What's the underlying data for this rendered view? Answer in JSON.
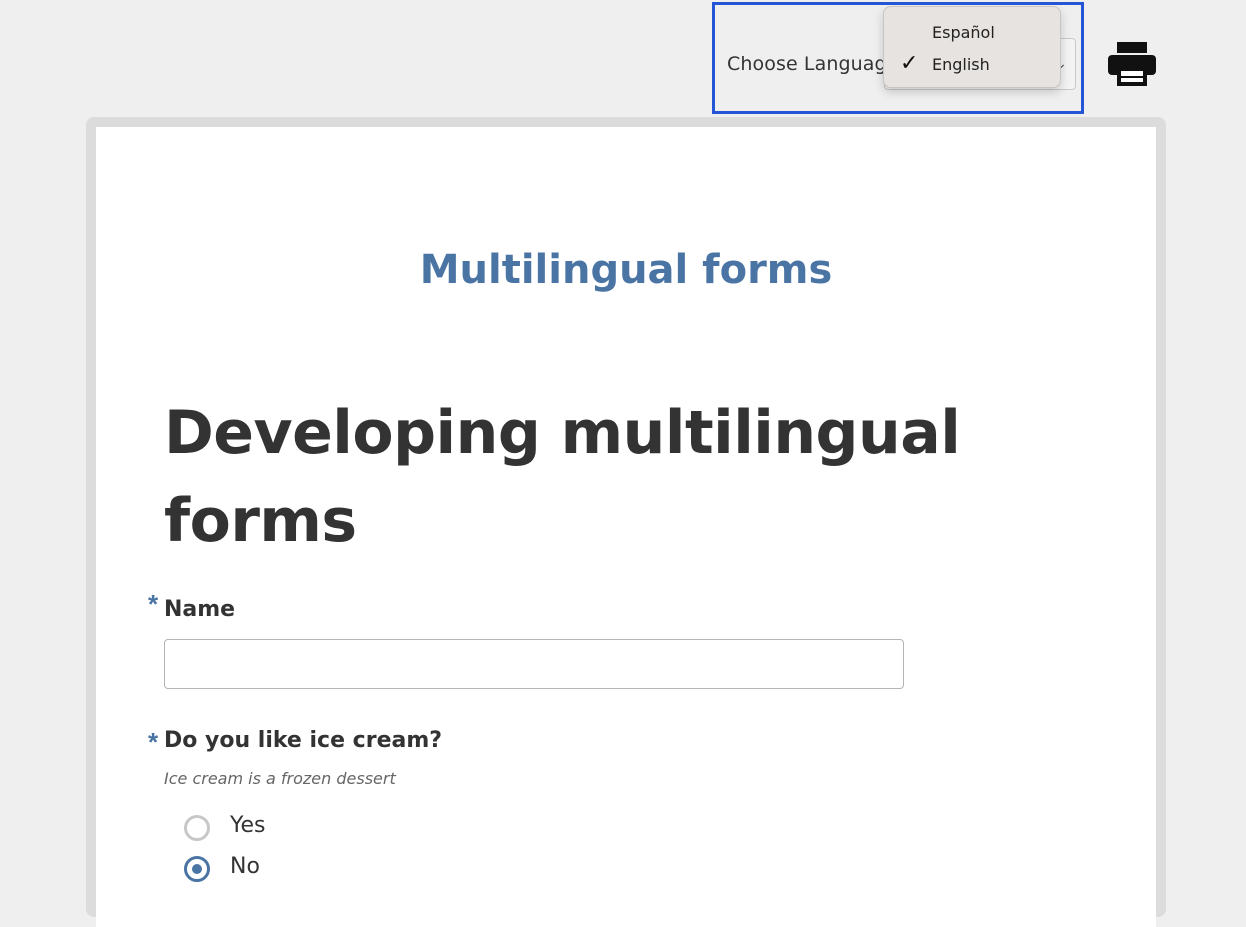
{
  "language_picker": {
    "label": "Choose Language",
    "options": [
      {
        "label": "Español",
        "selected": false
      },
      {
        "label": "English",
        "selected": true
      }
    ],
    "checkmark": "✓"
  },
  "print_button": {
    "icon": "printer-icon"
  },
  "form": {
    "title": "Multilingual forms",
    "heading": "Developing multilingual forms",
    "required_marker": "*",
    "fields": {
      "name": {
        "label": "Name",
        "value": "",
        "placeholder": ""
      },
      "ice_cream": {
        "label": "Do you like ice cream?",
        "help": "Ice cream is a frozen dessert",
        "options": [
          {
            "label": "Yes",
            "checked": false
          },
          {
            "label": "No",
            "checked": true
          }
        ]
      }
    }
  },
  "colors": {
    "accent": "#4a74a4",
    "highlight_border": "#2455d6",
    "background": "#efefef"
  }
}
